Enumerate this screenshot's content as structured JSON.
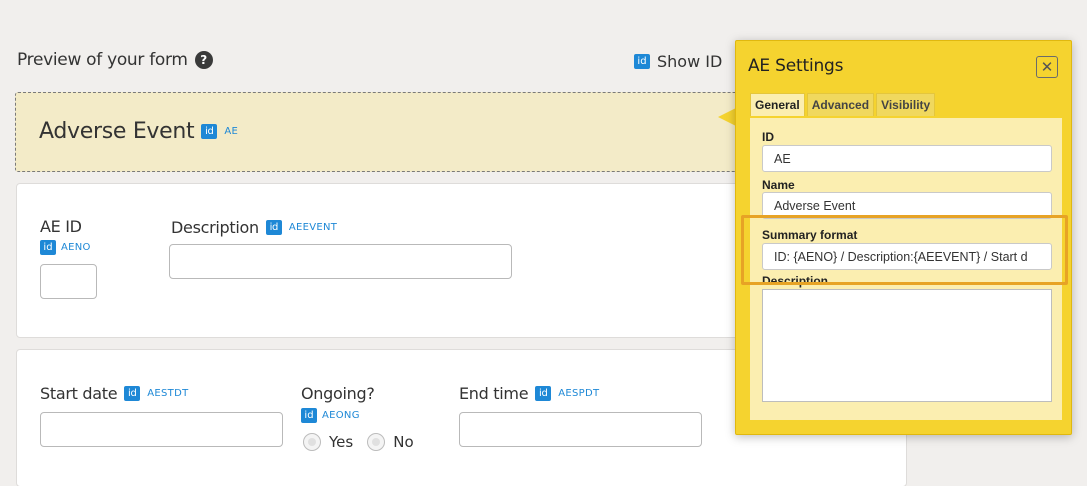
{
  "header": {
    "preview_title": "Preview of your form",
    "help_icon": "?",
    "show_ids_label": "Show ID"
  },
  "id_badge_text": "id",
  "group": {
    "title": "Adverse Event",
    "id_code": "AE"
  },
  "card1": {
    "ae_id_label": "AE ID",
    "ae_id_code": "AENO",
    "description_label": "Description",
    "description_code": "AEEVENT"
  },
  "card2": {
    "start_date_label": "Start date",
    "start_date_code": "AESTDT",
    "ongoing_label": "Ongoing?",
    "ongoing_code": "AEONG",
    "yes_label": "Yes",
    "no_label": "No",
    "end_time_label": "End time",
    "end_time_code": "AESPDT"
  },
  "popup": {
    "title": "AE Settings",
    "close_icon": "✕",
    "tabs": [
      "General",
      "Advanced",
      "Visibility"
    ],
    "id_label": "ID",
    "id_value": "AE",
    "name_label": "Name",
    "name_value": "Adverse Event",
    "summary_label": "Summary format",
    "summary_value": "ID: {AENO} / Description:{AEEVENT} / Start d",
    "description_label": "Description",
    "description_value": ""
  },
  "colors": {
    "background": "#f1efed",
    "id_badge": "#1e88d6",
    "popup": "#f5d32f",
    "panel": "#fbeeb0",
    "highlight": "#e7a325",
    "group_header": "#f3ebc8"
  }
}
